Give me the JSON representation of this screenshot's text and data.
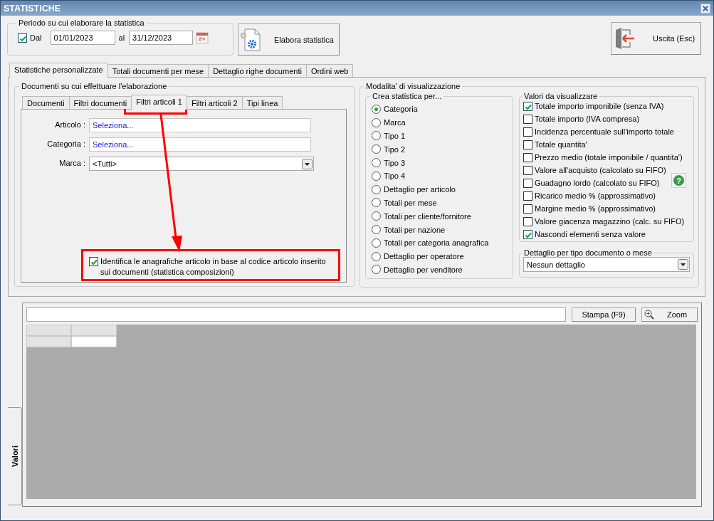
{
  "window": {
    "title": "STATISTICHE"
  },
  "period": {
    "legend": "Periodo su cui elaborare la statistica",
    "from_label": "Dal",
    "from_checked": true,
    "from": "01/01/2023",
    "to_label": "al",
    "to": "31/12/2023"
  },
  "actions": [
    {
      "kind": "process",
      "label": "Elabora statistica"
    },
    {
      "kind": "exit",
      "label": "Uscita (Esc)"
    }
  ],
  "tabs": [
    {
      "label": "Statistiche personalizzate",
      "selected": true
    },
    {
      "label": "Totali documenti per mese",
      "selected": false
    },
    {
      "label": "Dettaglio righe documenti",
      "selected": false
    },
    {
      "label": "Ordini web",
      "selected": false
    }
  ],
  "documents": {
    "legend": "Documenti su cui effettuare l'elaborazione",
    "tabs": [
      {
        "label": "Documenti",
        "selected": false
      },
      {
        "label": "Filtri documenti",
        "selected": false
      },
      {
        "label": "Filtri articoli 1",
        "selected": true
      },
      {
        "label": "Filtri articoli 2",
        "selected": false
      },
      {
        "label": "Tipi linea",
        "selected": false
      }
    ],
    "fields": [
      {
        "kind": "picker",
        "label": "Articolo :",
        "value": "Seleziona..."
      },
      {
        "kind": "picker",
        "label": "Categoria :",
        "value": "Seleziona..."
      },
      {
        "kind": "dropdown",
        "label": "Marca :",
        "value": "<Tutti>"
      }
    ],
    "identify": {
      "label": "Identifica le anagrafiche articolo in base al codice articolo inserito sui documenti (statistica composizioni)",
      "checked": true
    }
  },
  "display": {
    "legend": "Modalita' di visualizzazione",
    "group_by": {
      "legend": "Crea statistica per...",
      "options": [
        {
          "label": "Categoria",
          "selected": true
        },
        {
          "label": "Marca",
          "selected": false
        },
        {
          "label": "Tipo 1",
          "selected": false
        },
        {
          "label": "Tipo 2",
          "selected": false
        },
        {
          "label": "Tipo 3",
          "selected": false
        },
        {
          "label": "Tipo 4",
          "selected": false
        },
        {
          "label": "Dettaglio per articolo",
          "selected": false
        },
        {
          "label": "Totali per mese",
          "selected": false
        },
        {
          "label": "Totali per cliente/fornitore",
          "selected": false
        },
        {
          "label": "Totali per nazione",
          "selected": false
        },
        {
          "label": "Totali per categoria anagrafica",
          "selected": false
        },
        {
          "label": "Dettaglio per operatore",
          "selected": false
        },
        {
          "label": "Dettaglio per venditore",
          "selected": false
        }
      ]
    },
    "values": {
      "legend": "Valori da visualizzare",
      "help": "?",
      "options": [
        {
          "label": "Totale importo imponibile (senza IVA)",
          "checked": true
        },
        {
          "label": "Totale importo (IVA compresa)",
          "checked": false
        },
        {
          "label": "Incidenza percentuale sull'importo totale",
          "checked": false
        },
        {
          "label": "Totale quantita'",
          "checked": false
        },
        {
          "label": "Prezzo medio (totale imponibile / quantita')",
          "checked": false
        },
        {
          "label": "Valore all'acquisto (calcolato su FIFO)",
          "checked": false
        },
        {
          "label": "Guadagno lordo (calcolato su FIFO)",
          "checked": false
        },
        {
          "label": "Ricarico medio % (approssimativo)",
          "checked": false
        },
        {
          "label": "Margine medio % (approssimativo)",
          "checked": false
        },
        {
          "label": "Valore giacenza magazzino (calc. su FIFO)",
          "checked": false
        },
        {
          "label": "Nascondi elementi senza valore",
          "checked": true
        }
      ]
    },
    "detail": {
      "legend": "Dettaglio per tipo documento o mese",
      "value": "Nessun dettaglio"
    }
  },
  "results": {
    "buttons": [
      {
        "kind": "print",
        "label": "Stampa (F9)"
      },
      {
        "kind": "zoom",
        "label": "Zoom"
      }
    ],
    "side_tab": "Valori"
  }
}
